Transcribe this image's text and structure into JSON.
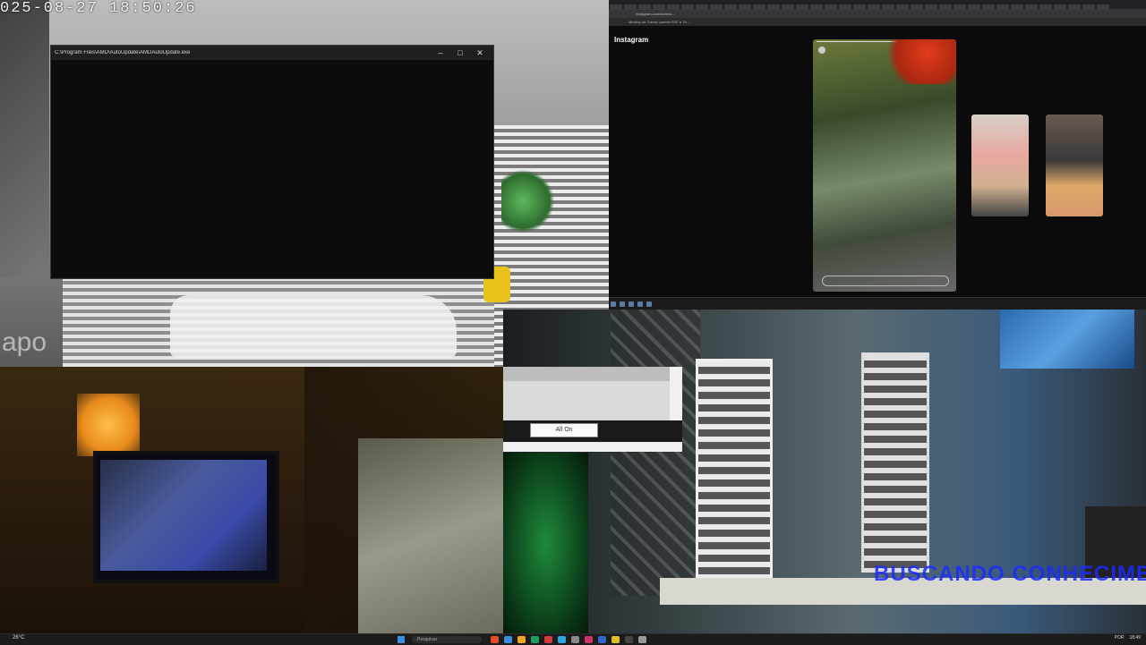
{
  "camera": {
    "timestamp": "025-08-27  18:50:26",
    "logo": "apo"
  },
  "console_window": {
    "title": "C:\\Program Files\\AMD\\AutoUpdate\\AMDAutoUpdate.exe",
    "controls": [
      "–",
      "□",
      "✕"
    ]
  },
  "browser": {
    "url": "instagram.com/stories/...",
    "bookmarks": "Ministry de Transit    Lamela PDF a Tri...",
    "site_logo": "Instagram"
  },
  "dialog": {
    "button_label": "All On"
  },
  "overlay_text": "BUSCANDO CONHECIMENT",
  "taskbar": {
    "weather": "26°C",
    "search_placeholder": "Pesquisar",
    "lang": "POR",
    "time": "18:49",
    "app_colors": [
      "#e34c26",
      "#3a8de0",
      "#f0a820",
      "#1aa05a",
      "#d23b3b",
      "#2aa8e0",
      "#888888",
      "#cc3366",
      "#3366cc",
      "#e0c020",
      "#444444",
      "#999999"
    ]
  }
}
